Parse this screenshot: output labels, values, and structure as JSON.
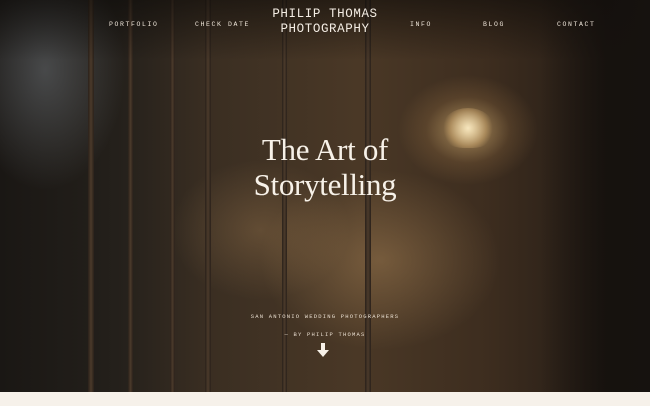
{
  "nav": {
    "left": [
      "Portfolio",
      "Check Date"
    ],
    "right": [
      "Info",
      "Blog",
      "Contact"
    ]
  },
  "brand": {
    "line1": "PHILIP THOMAS",
    "line2": "PHOTOGRAPHY"
  },
  "hero": {
    "title_line1": "The Art of",
    "title_line2": "Storytelling",
    "subtitle": "San Antonio Wedding Photographers",
    "byline": "— By Philip Thomas"
  },
  "icons": {
    "scroll": "arrow-down-icon"
  },
  "colors": {
    "text": "#f7f1e8",
    "page_background": "#f6f1ea"
  }
}
